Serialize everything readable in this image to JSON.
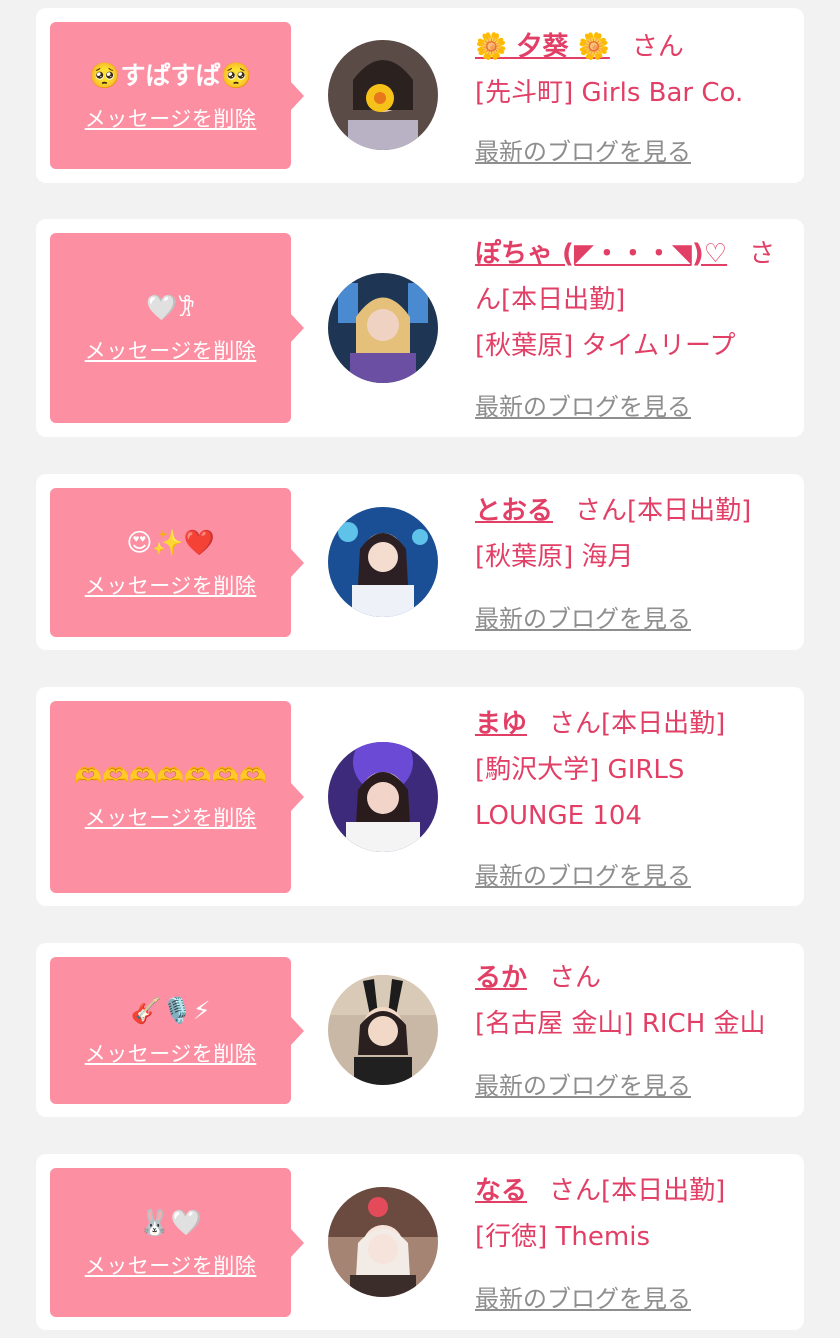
{
  "delete_label": "メッセージを削除",
  "honorific": "さん",
  "blog_link_label": "最新のブログを見る",
  "colors": {
    "bubble": "#fd8fa3",
    "accent": "#e23f66",
    "link_gray": "#8e8e8e",
    "background": "#f2f2f2"
  },
  "cards": [
    {
      "message": "🥺すぱすぱ🥺",
      "name": "🌼 夕葵 🌼",
      "status": "",
      "shop": "[先斗町] Girls Bar Co."
    },
    {
      "message": "🤍𐦂",
      "name": "ぽちゃ (◤・・・◥)♡",
      "status": "[本日出勤]",
      "shop": "[秋葉原] タイムリープ"
    },
    {
      "message": "😍✨❤️",
      "name": "とおる",
      "status": "[本日出勤]",
      "shop": "[秋葉原] 海月"
    },
    {
      "message": "🫶🫶🫶🫶🫶🫶🫶",
      "name": "まゆ",
      "status": "[本日出勤]",
      "shop": "[駒沢大学] GIRLS LOUNGE 104"
    },
    {
      "message": "🎸🎙️⚡",
      "name": "るか",
      "status": "",
      "shop": "[名古屋 金山] RICH 金山"
    },
    {
      "message": "🐰🤍",
      "name": "なる",
      "status": "[本日出勤]",
      "shop": "[行徳] Themis"
    }
  ]
}
